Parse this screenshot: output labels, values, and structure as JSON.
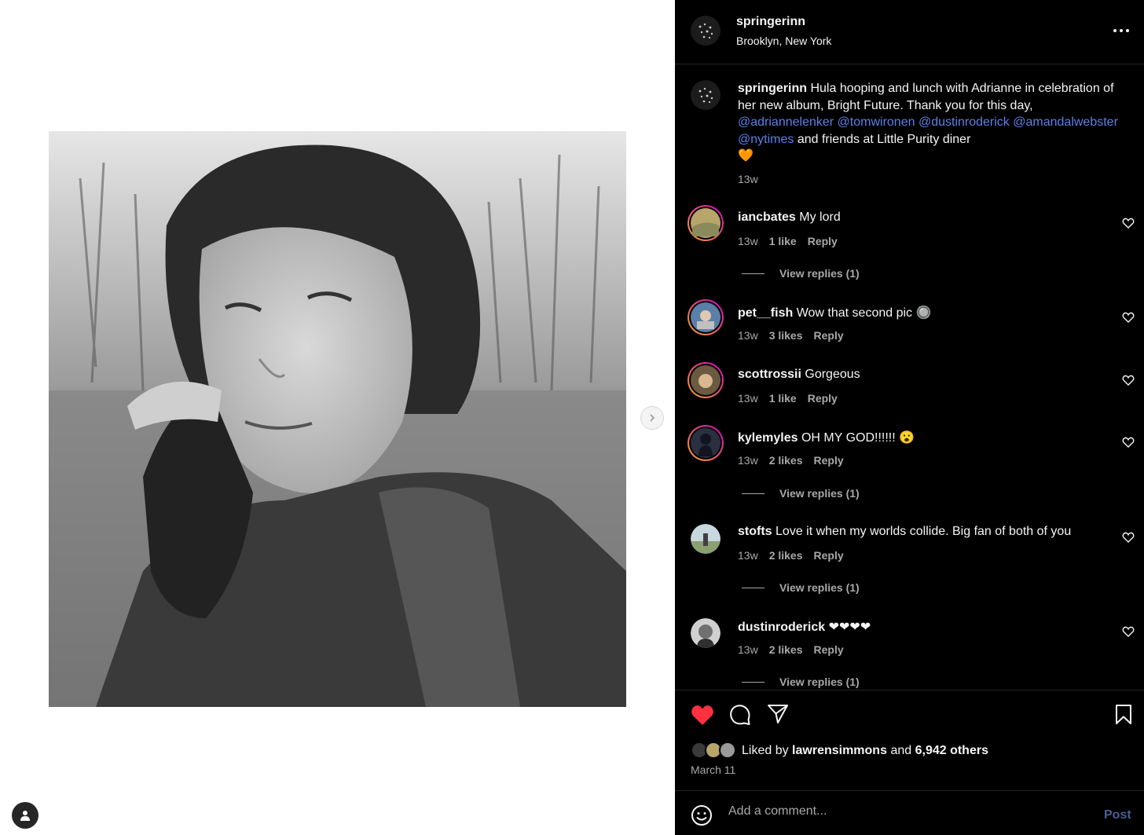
{
  "post": {
    "username": "springerinn",
    "location": "Brooklyn, New York",
    "caption": {
      "username": "springerinn",
      "text_before": "Hula hooping and lunch with Adrianne in celebration of her new album, Bright Future. Thank you for this day,",
      "mentions": [
        "@adriannelenker",
        "@tomwironen",
        "@dustinroderick",
        "@amandalwebster",
        "@nytimes"
      ],
      "text_after": "and friends at Little Purity diner",
      "emoji": "🧡",
      "time": "13w"
    }
  },
  "comments": [
    {
      "username": "iancbates",
      "text": "My lord",
      "time": "13w",
      "likes": "1 like",
      "reply_label": "Reply",
      "view_replies": "View replies (1)"
    },
    {
      "username": "pet__fish",
      "text": "Wow that second pic 🔘",
      "time": "13w",
      "likes": "3 likes",
      "reply_label": "Reply",
      "view_replies": ""
    },
    {
      "username": "scottrossii",
      "text": "Gorgeous",
      "time": "13w",
      "likes": "1 like",
      "reply_label": "Reply",
      "view_replies": ""
    },
    {
      "username": "kylemyles",
      "text": "OH MY GOD!!!!!! 😮",
      "time": "13w",
      "likes": "2 likes",
      "reply_label": "Reply",
      "view_replies": "View replies (1)"
    },
    {
      "username": "stofts",
      "text": "Love it when my worlds collide. Big fan of both of you",
      "time": "13w",
      "likes": "2 likes",
      "reply_label": "Reply",
      "view_replies": "View replies (1)"
    },
    {
      "username": "dustinroderick",
      "text": "❤❤❤❤",
      "time": "13w",
      "likes": "2 likes",
      "reply_label": "Reply",
      "view_replies": "View replies (1)"
    }
  ],
  "likes": {
    "prefix": "Liked by",
    "user": "lawrensimmons",
    "and": "and",
    "others": "6,942 others"
  },
  "date": "March 11",
  "add_comment": {
    "placeholder": "Add a comment...",
    "post_label": "Post"
  },
  "colors": {
    "accent_like": "#ff3040",
    "mention": "#5f7fe8",
    "post_button": "#4a5e94",
    "story_ring_start": "#f9a825",
    "story_ring_end": "#d300c5"
  },
  "icons": [
    "chevron-right-icon",
    "more-icon",
    "heart-icon",
    "comment-icon",
    "share-icon",
    "bookmark-icon",
    "emoji-icon",
    "user-icon"
  ]
}
